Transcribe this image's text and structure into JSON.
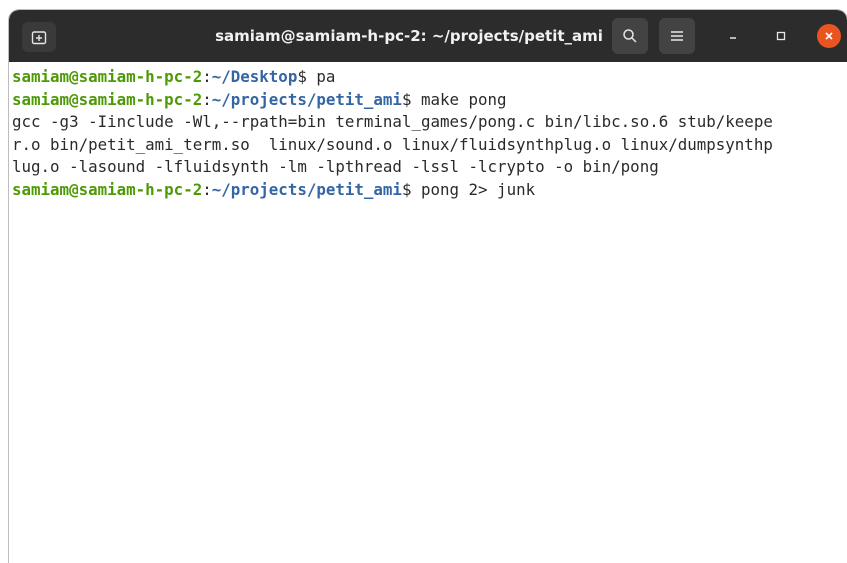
{
  "window": {
    "title": "samiam@samiam-h-pc-2: ~/projects/petit_ami"
  },
  "icons": {
    "new_tab": "new-tab-icon",
    "search": "search-icon",
    "menu": "hamburger-menu-icon",
    "minimize": "minimize-icon",
    "maximize": "maximize-icon",
    "close": "close-icon"
  },
  "colors": {
    "titlebar": "#2c2c2c",
    "prompt_user": "#4e9a06",
    "prompt_path": "#3465a4",
    "close_button": "#e95420",
    "terminal_bg": "#ffffff",
    "terminal_text": "#2a2a2a"
  },
  "terminal": {
    "lines": [
      {
        "user": "samiam@samiam-h-pc-2",
        "colon": ":",
        "path": "~/Desktop",
        "cmd": "$ pa"
      },
      {
        "user": "samiam@samiam-h-pc-2",
        "colon": ":",
        "path": "~/projects/petit_ami",
        "cmd": "$ make pong"
      },
      {
        "text": "gcc -g3 -Iinclude -Wl,--rpath=bin terminal_games/pong.c bin/libc.so.6 stub/keepe"
      },
      {
        "text": "r.o bin/petit_ami_term.so  linux/sound.o linux/fluidsynthplug.o linux/dumpsynthp"
      },
      {
        "text": "lug.o -lasound -lfluidsynth -lm -lpthread -lssl -lcrypto -o bin/pong"
      },
      {
        "user": "samiam@samiam-h-pc-2",
        "colon": ":",
        "path": "~/projects/petit_ami",
        "cmd": "$ pong 2> junk"
      }
    ]
  }
}
